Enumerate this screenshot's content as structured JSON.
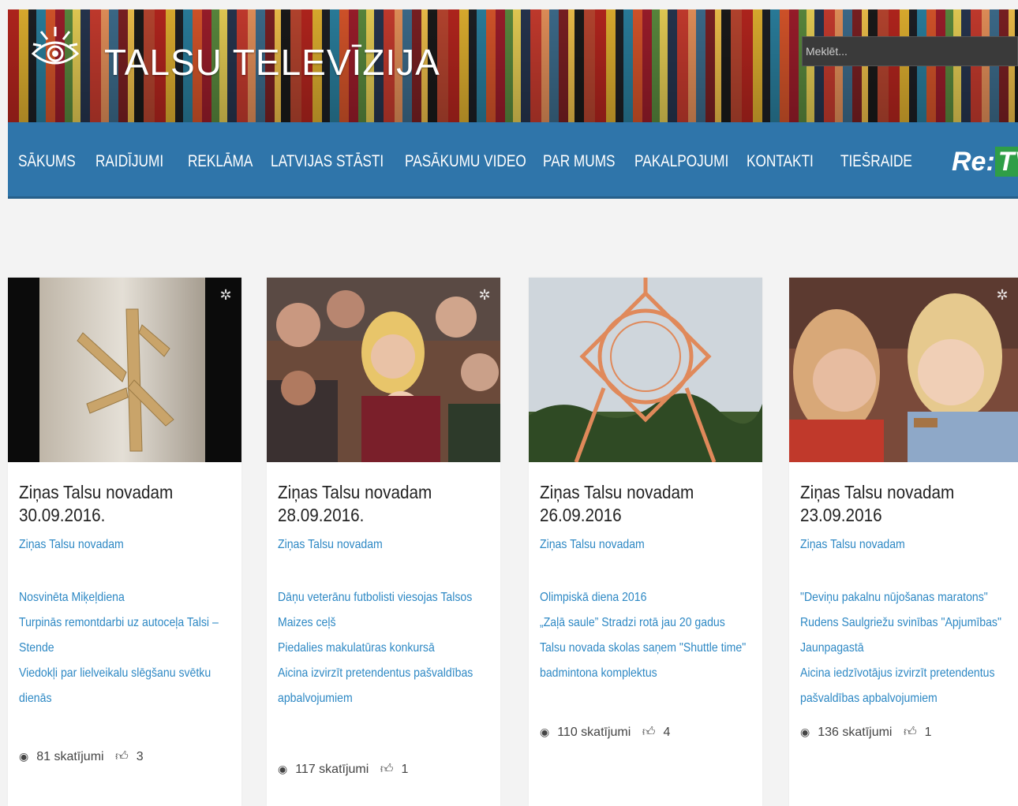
{
  "header": {
    "site_title": "TALSU TELEVĪZIJA",
    "search_placeholder": "Meklēt..."
  },
  "nav": {
    "items": [
      "SĀKUMS",
      "RAIDĪJUMI",
      "REKLĀMA",
      "LATVIJAS STĀSTI",
      "PASĀKUMU VIDEO",
      "PAR MUMS",
      "PAKALPOJUMI",
      "KONTAKTI",
      "TIEŠRAIDE"
    ],
    "retv_re": "Re:",
    "retv_tv": "TV"
  },
  "cards": [
    {
      "title_line1": "Ziņas Talsu novadam",
      "title_line2": "30.09.2016.",
      "category": "Ziņas Talsu novadam",
      "links": [
        "Nosvinēta Miķeļdiena",
        "Turpinās remontdarbi uz autoceļa Talsi – Stende",
        "Viedokļi par lielveikalu slēgšanu svētku dienās"
      ],
      "views": "81 skatījumi",
      "likes": "3"
    },
    {
      "title_line1": "Ziņas Talsu novadam",
      "title_line2": "28.09.2016.",
      "category": "Ziņas Talsu novadam",
      "links": [
        "Dāņu veterānu futbolisti viesojas Talsos",
        "Maizes ceļš",
        "Piedalies makulatūras konkursā",
        "Aicina izvirzīt pretendentus pašvaldības apbalvojumiem"
      ],
      "views": "117 skatījumi",
      "likes": "1"
    },
    {
      "title_line1": "Ziņas Talsu novadam",
      "title_line2": "26.09.2016",
      "category": "Ziņas Talsu novadam",
      "links": [
        "Olimpiskā diena 2016",
        "„Zaļā saule” Stradzi rotā jau 20 gadus",
        "Talsu novada skolas saņem \"Shuttle time\" badmintona komplektus"
      ],
      "views": "110 skatījumi",
      "likes": "4"
    },
    {
      "title_line1": "Ziņas Talsu novadam",
      "title_line2": "23.09.2016",
      "category": "Ziņas Talsu novadam",
      "links": [
        "\"Deviņu pakalnu nūjošanas maratons\"",
        "Rudens Saulgriežu svinības \"Apjumības\" Jaunpagastā",
        "Aicina iedzīvotājus izvirzīt pretendentus pašvaldības apbalvojumiem"
      ],
      "views": "136 skatījumi",
      "likes": "1"
    }
  ],
  "icons": {
    "logo": "eye-sun-logo",
    "views": "eye-icon",
    "likes": "thumbs-up-icon",
    "channel_badge": "eye-logo-badge"
  }
}
